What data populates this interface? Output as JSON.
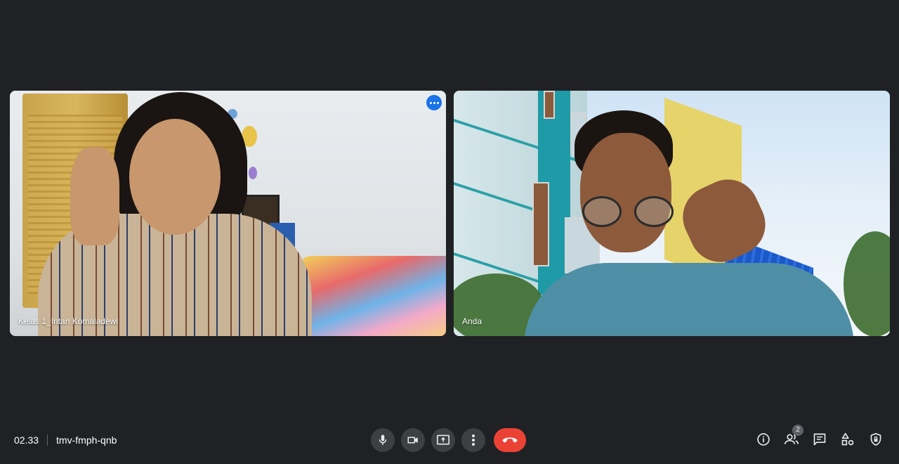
{
  "participants": [
    {
      "name": "Kelas 1_Intan Komaladewi",
      "has_menu": true
    },
    {
      "name": "Anda"
    }
  ],
  "bottom_bar": {
    "time": "02.33",
    "meeting_code": "tmv-fmph-qnb",
    "people_count": "2"
  },
  "icons": {
    "mic": "microphone-icon",
    "camera": "camera-icon",
    "present": "present-screen-icon",
    "more": "more-options-icon",
    "leave": "end-call-icon",
    "info": "info-icon",
    "people": "people-icon",
    "chat": "chat-icon",
    "activities": "activities-icon",
    "host": "host-controls-icon"
  },
  "colors": {
    "background": "#202124",
    "active_speaker_border": "#669df6",
    "end_call": "#ea4335",
    "control_bg": "#3c4043"
  }
}
